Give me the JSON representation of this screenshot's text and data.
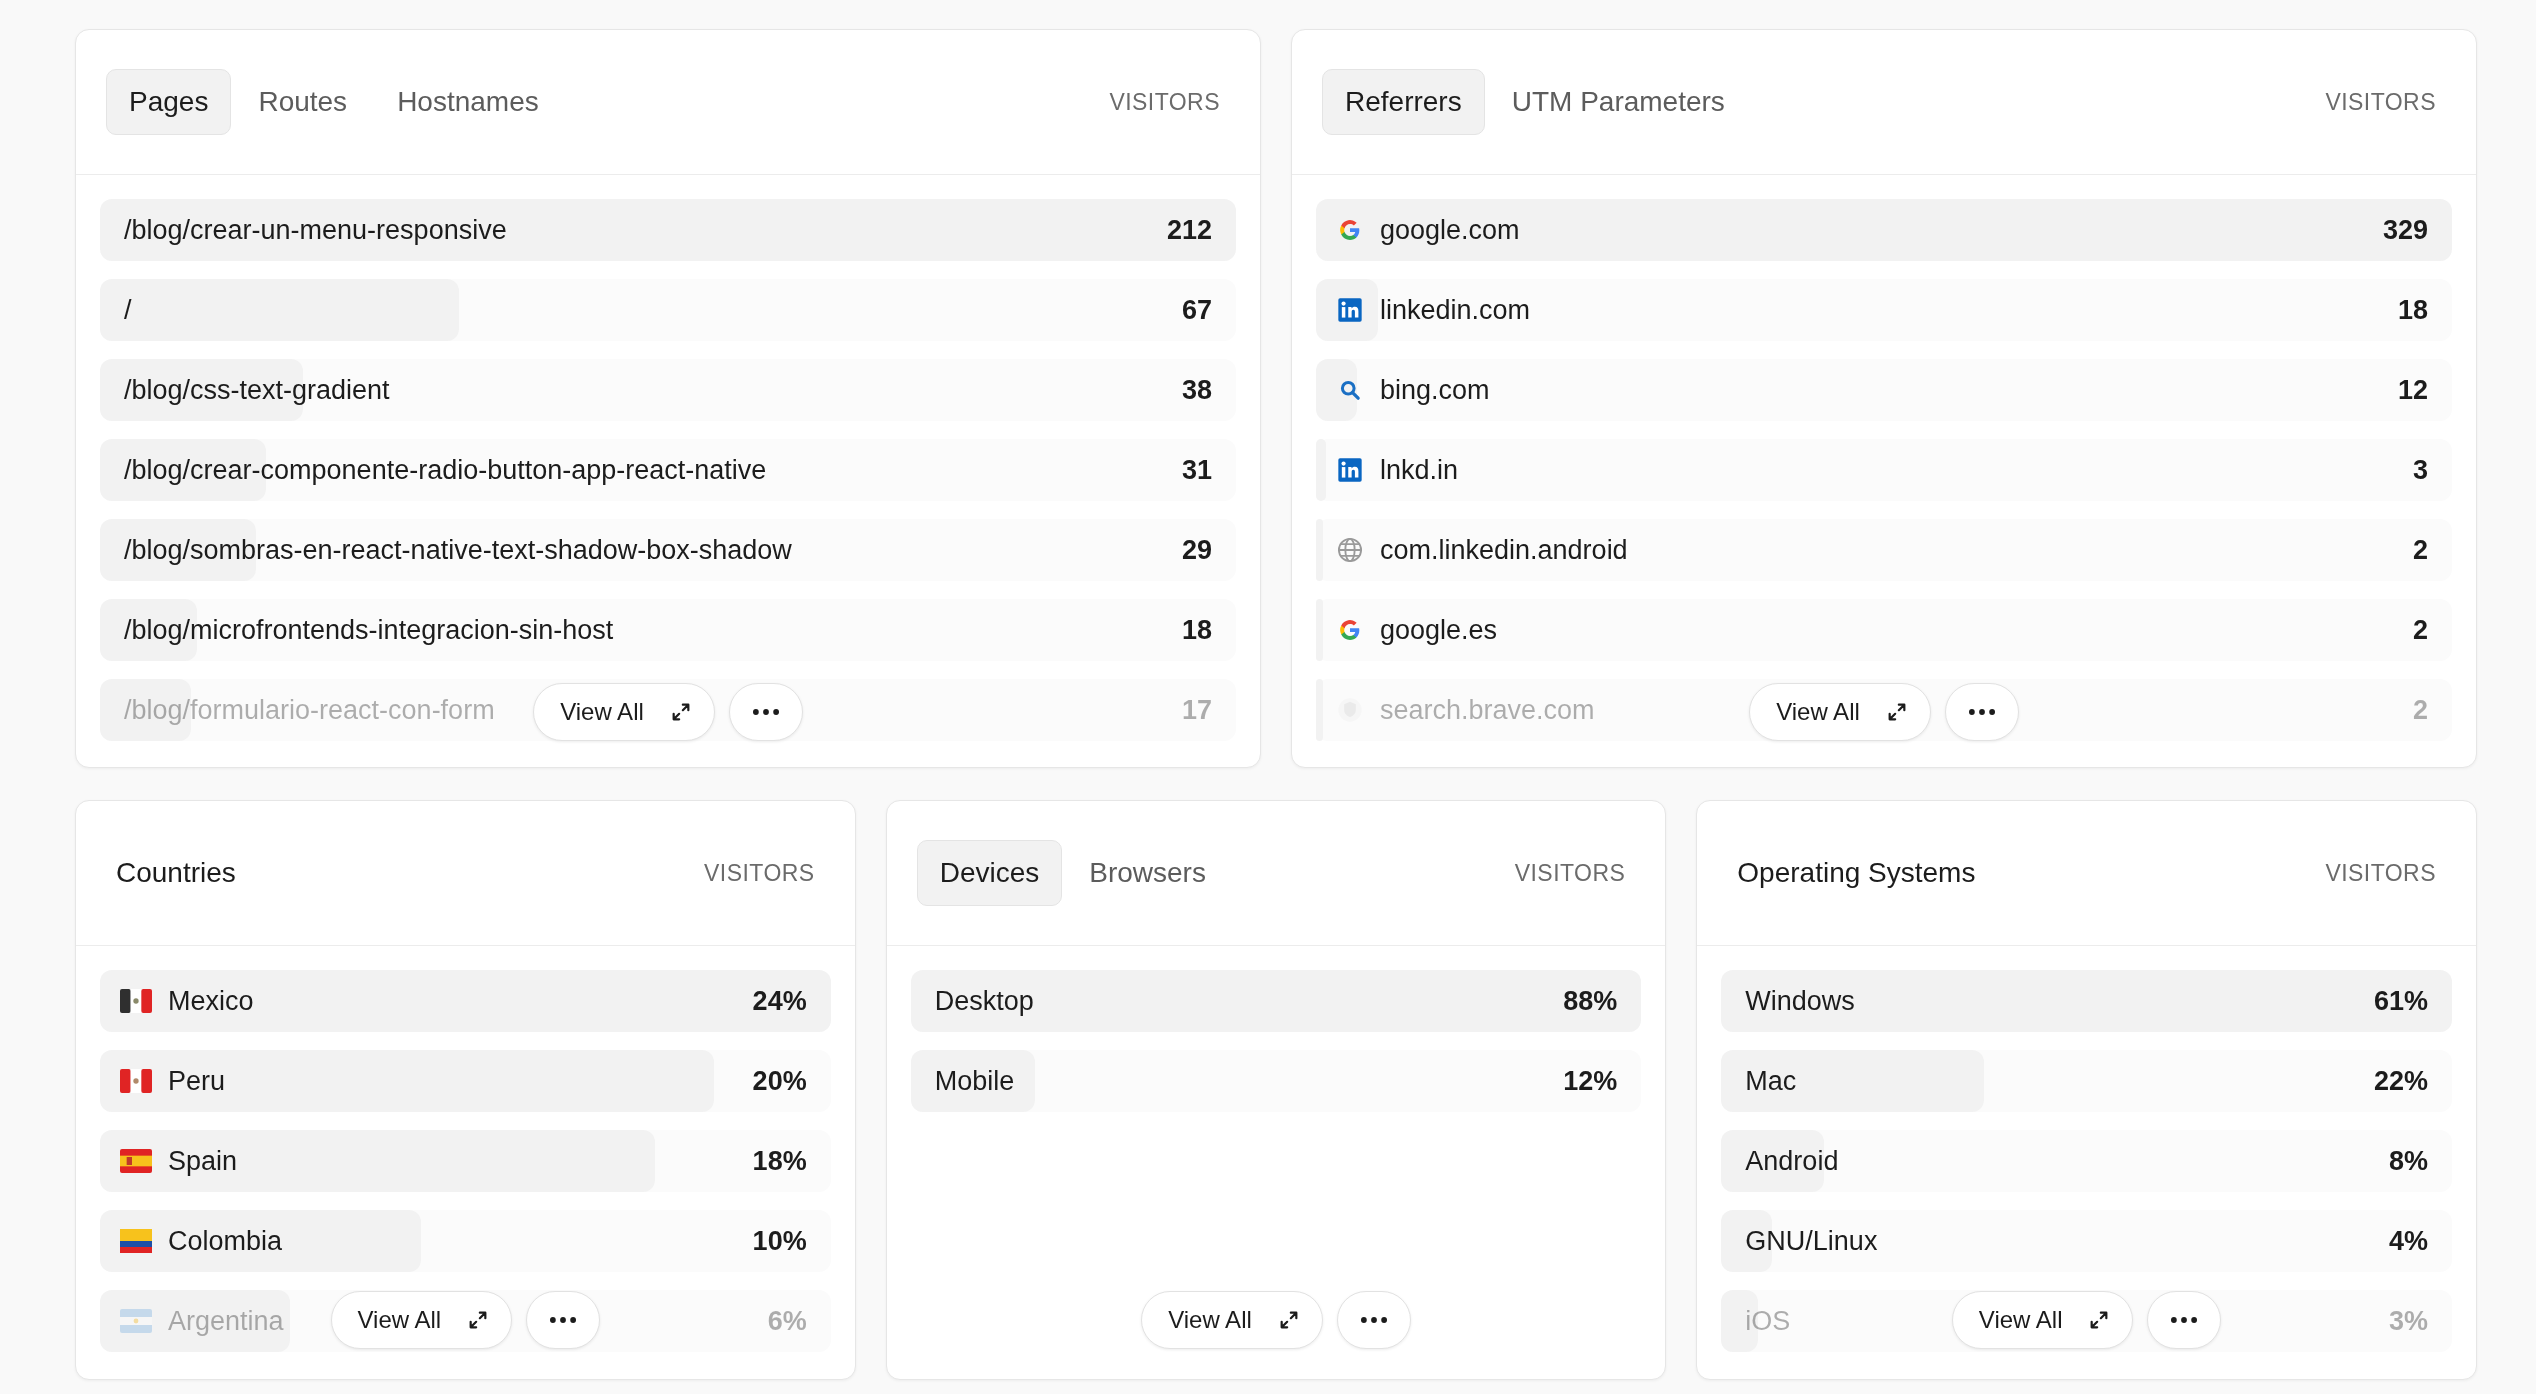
{
  "top_panels": [
    {
      "tabs": [
        {
          "label": "Pages",
          "selected": true
        },
        {
          "label": "Routes",
          "selected": false
        },
        {
          "label": "Hostnames",
          "selected": false
        }
      ],
      "column_label": "VISITORS",
      "view_all": "View All",
      "rows": [
        {
          "label": "/blog/crear-un-menu-responsive",
          "value": "212",
          "level": 1
        },
        {
          "label": "/",
          "value": "67",
          "level": 0.316
        },
        {
          "label": "/blog/css-text-gradient",
          "value": "38",
          "level": 0.179
        },
        {
          "label": "/blog/crear-componente-radio-button-app-react-native",
          "value": "31",
          "level": 0.146
        },
        {
          "label": "/blog/sombras-en-react-native-text-shadow-box-shadow",
          "value": "29",
          "level": 0.137
        },
        {
          "label": "/blog/microfrontends-integracion-sin-host",
          "value": "18",
          "level": 0.085
        },
        {
          "label": "/blog/formulario-react-con-form",
          "value": "17",
          "level": 0.08
        }
      ]
    },
    {
      "tabs": [
        {
          "label": "Referrers",
          "selected": true
        },
        {
          "label": "UTM Parameters",
          "selected": false
        }
      ],
      "column_label": "VISITORS",
      "view_all": "View All",
      "rows": [
        {
          "label": "google.com",
          "value": "329",
          "level": 1,
          "kind": "g"
        },
        {
          "label": "linkedin.com",
          "value": "18",
          "level": 0.055,
          "kind": "in"
        },
        {
          "label": "bing.com",
          "value": "12",
          "level": 0.036,
          "kind": "search"
        },
        {
          "label": "lnkd.in",
          "value": "3",
          "level": 0.009,
          "kind": "in"
        },
        {
          "label": "com.linkedin.android",
          "value": "2",
          "level": 0.006,
          "kind": "globe"
        },
        {
          "label": "google.es",
          "value": "2",
          "level": 0.006,
          "kind": "g"
        },
        {
          "label": "search.brave.com",
          "value": "2",
          "level": 0.006,
          "kind": "shield"
        }
      ]
    }
  ],
  "bottom_panels": [
    {
      "title": "Countries",
      "column_label": "VISITORS",
      "view_all": "View All",
      "rows": [
        {
          "label": "Mexico",
          "value": "24%",
          "level": 1,
          "kind": "mx"
        },
        {
          "label": "Peru",
          "value": "20%",
          "level": 0.84,
          "kind": "pe"
        },
        {
          "label": "Spain",
          "value": "18%",
          "level": 0.76,
          "kind": "es"
        },
        {
          "label": "Colombia",
          "value": "10%",
          "level": 0.44,
          "kind": "co"
        },
        {
          "label": "Argentina",
          "value": "6%",
          "level": 0.26,
          "kind": "ar"
        }
      ]
    },
    {
      "tabs": [
        {
          "label": "Devices",
          "selected": true
        },
        {
          "label": "Browsers",
          "selected": false
        }
      ],
      "column_label": "VISITORS",
      "view_all": "View All",
      "rows": [
        {
          "label": "Desktop",
          "value": "88%",
          "level": 1
        },
        {
          "label": "Mobile",
          "value": "12%",
          "level": 0.17
        }
      ]
    },
    {
      "title": "Operating Systems",
      "column_label": "VISITORS",
      "view_all": "View All",
      "rows": [
        {
          "label": "Windows",
          "value": "61%",
          "level": 1
        },
        {
          "label": "Mac",
          "value": "22%",
          "level": 0.36
        },
        {
          "label": "Android",
          "value": "8%",
          "level": 0.14
        },
        {
          "label": "GNU/Linux",
          "value": "4%",
          "level": 0.07
        },
        {
          "label": "iOS",
          "value": "3%",
          "level": 0.05
        }
      ]
    }
  ]
}
